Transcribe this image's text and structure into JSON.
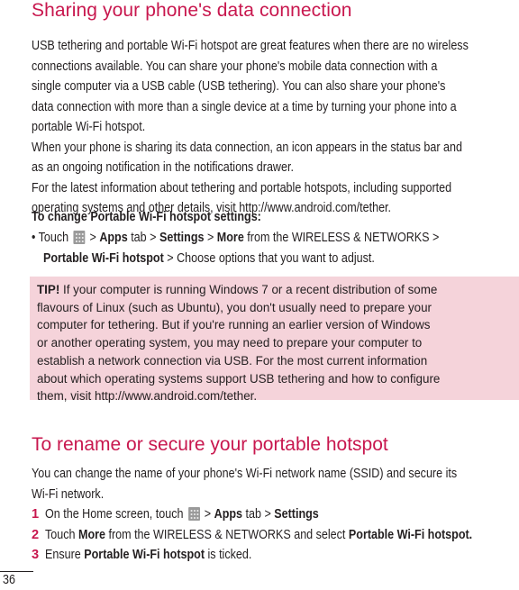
{
  "section1": {
    "heading": "Sharing your phone's data connection",
    "intro_lines": [
      "USB tethering and portable Wi-Fi hotspot are great features when there are no wireless",
      "connections available. You can share your phone's mobile data connection with a",
      "single computer via a USB cable (USB tethering). You can also share your phone's",
      "data connection with more than a single device at a time by turning your phone into a",
      "portable Wi-Fi hotspot.",
      "When your phone is sharing its data connection, an icon appears in the status bar and",
      "as an ongoing notification in the notifications drawer.",
      "For the latest information about tethering and portable hotspots, including supported",
      "operating systems and other details, visit http://www.android.com/tether."
    ],
    "subheading": "To change Portable Wi-Fi hotspot settings:",
    "bullet": {
      "marker": "•",
      "touch": "Touch",
      "sep": ">",
      "apps": "Apps",
      "tab": "tab",
      "settings": "Settings",
      "more": "More",
      "from_wireless": "from the WIRELESS & NETWORKS >",
      "portable": "Portable Wi-Fi hotspot",
      "choose": "> Choose options that you want to adjust.",
      "icon": "apps-grid-icon"
    }
  },
  "tip": {
    "label": "TIP!",
    "lines": [
      " If your computer is running Windows 7 or a recent distribution of some",
      "flavours of Linux (such as Ubuntu), you don't usually need to prepare your",
      "computer for tethering. But if you're running an earlier version of Windows",
      "or another operating system, you may need to prepare your computer to",
      "establish a network connection via USB. For the most current information",
      "about which operating systems support USB tethering and how to configure",
      "them, visit http://www.android.com/tether."
    ],
    "background": "#f5d3da"
  },
  "section2": {
    "heading": "To rename or secure your portable hotspot",
    "intro_lines": [
      "You can change the name of your phone's Wi-Fi network name (SSID) and secure its",
      "Wi-Fi network."
    ],
    "steps": [
      {
        "num": "1",
        "pre": "On the Home screen, touch",
        "sep1": ">",
        "b1": "Apps",
        "mid": "tab >",
        "b2": "Settings"
      },
      {
        "num": "2",
        "pre": "Touch",
        "b1": "More",
        "mid": "from the WIRELESS & NETWORKS and select",
        "b2": "Portable Wi-Fi hotspot."
      },
      {
        "num": "3",
        "pre": "Ensure",
        "b1": "Portable Wi-Fi hotspot",
        "mid": "is ticked."
      }
    ]
  },
  "footer": {
    "page_number": "36"
  },
  "colors": {
    "accent": "#c8174e",
    "text": "#231f20"
  }
}
